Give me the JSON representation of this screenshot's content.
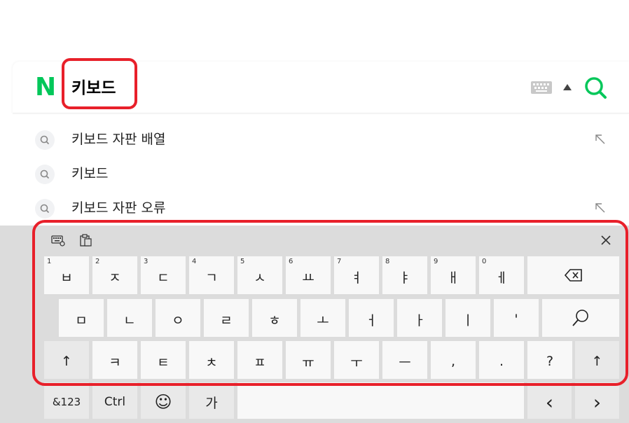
{
  "search": {
    "logo": "N",
    "query": "키보드",
    "colors": {
      "brand_green": "#03c75a",
      "annotation_red": "#e8202a"
    }
  },
  "suggestions": [
    {
      "text": "키보드 자판 배열",
      "has_arrow": true
    },
    {
      "text": "키보드",
      "has_arrow": false
    },
    {
      "text": "키보드 자판 오류",
      "has_arrow": true
    }
  ],
  "keyboard": {
    "row1": [
      {
        "num": "1",
        "label": "ㅂ"
      },
      {
        "num": "2",
        "label": "ㅈ"
      },
      {
        "num": "3",
        "label": "ㄷ"
      },
      {
        "num": "4",
        "label": "ㄱ"
      },
      {
        "num": "5",
        "label": "ㅅ"
      },
      {
        "num": "6",
        "label": "ㅛ"
      },
      {
        "num": "7",
        "label": "ㅕ"
      },
      {
        "num": "8",
        "label": "ㅑ"
      },
      {
        "num": "9",
        "label": "ㅐ"
      },
      {
        "num": "0",
        "label": "ㅔ"
      },
      {
        "num": "",
        "label": "⌫",
        "icon": "backspace-icon"
      }
    ],
    "row2": [
      {
        "label": "ㅁ"
      },
      {
        "label": "ㄴ"
      },
      {
        "label": "ㅇ"
      },
      {
        "label": "ㄹ"
      },
      {
        "label": "ㅎ"
      },
      {
        "label": "ㅗ"
      },
      {
        "label": "ㅓ"
      },
      {
        "label": "ㅏ"
      },
      {
        "label": "ㅣ"
      },
      {
        "label": "'"
      },
      {
        "label": "",
        "icon": "search-key-icon"
      }
    ],
    "row3": [
      {
        "label": "↑",
        "icon": "shift-left-icon"
      },
      {
        "label": "ㅋ"
      },
      {
        "label": "ㅌ"
      },
      {
        "label": "ㅊ"
      },
      {
        "label": "ㅍ"
      },
      {
        "label": "ㅠ"
      },
      {
        "label": "ㅜ"
      },
      {
        "label": "ㅡ"
      },
      {
        "label": ","
      },
      {
        "label": "."
      },
      {
        "label": "?"
      },
      {
        "label": "↑",
        "icon": "shift-right-icon"
      }
    ],
    "row4": {
      "symbols": "&123",
      "ctrl": "Ctrl",
      "emoji": "☺",
      "lang": "가",
      "left": "‹",
      "right": "›"
    }
  }
}
